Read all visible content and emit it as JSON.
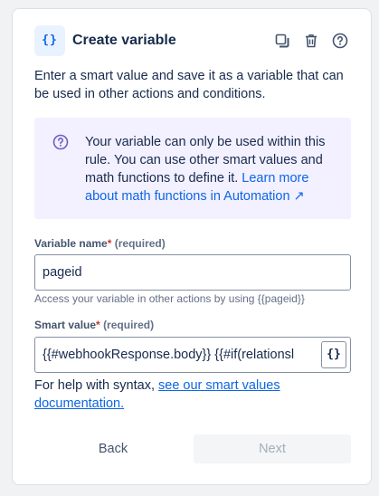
{
  "header": {
    "icon": "{}",
    "title": "Create variable",
    "actions": [
      "duplicate-icon",
      "trash-icon",
      "help-icon"
    ]
  },
  "description": "Enter a smart value and save it as a variable that can be used in other actions and conditions.",
  "info": {
    "text": "Your variable can only be used within this rule. You can use other smart values and math functions to define it.",
    "link": "Learn more about math functions in Automation ↗"
  },
  "variable_name": {
    "label": "Variable name",
    "required_marker": "*",
    "required_text": "(required)",
    "value": "pageid",
    "hint": "Access your variable in other actions by using {{pageid}}"
  },
  "smart_value": {
    "label": "Smart value",
    "required_marker": "*",
    "required_text": "(required)",
    "value": "{{#webhookResponse.body}}   {{#if(relationsl",
    "button_icon": "{}"
  },
  "help": {
    "text": "For help with syntax,",
    "link": "see our smart values documentation."
  },
  "footer": {
    "back_label": "Back",
    "next_label": "Next"
  },
  "colors": {
    "accent": "#0c66e4",
    "info_bg": "#f3f0ff",
    "required": "#c9372c"
  }
}
